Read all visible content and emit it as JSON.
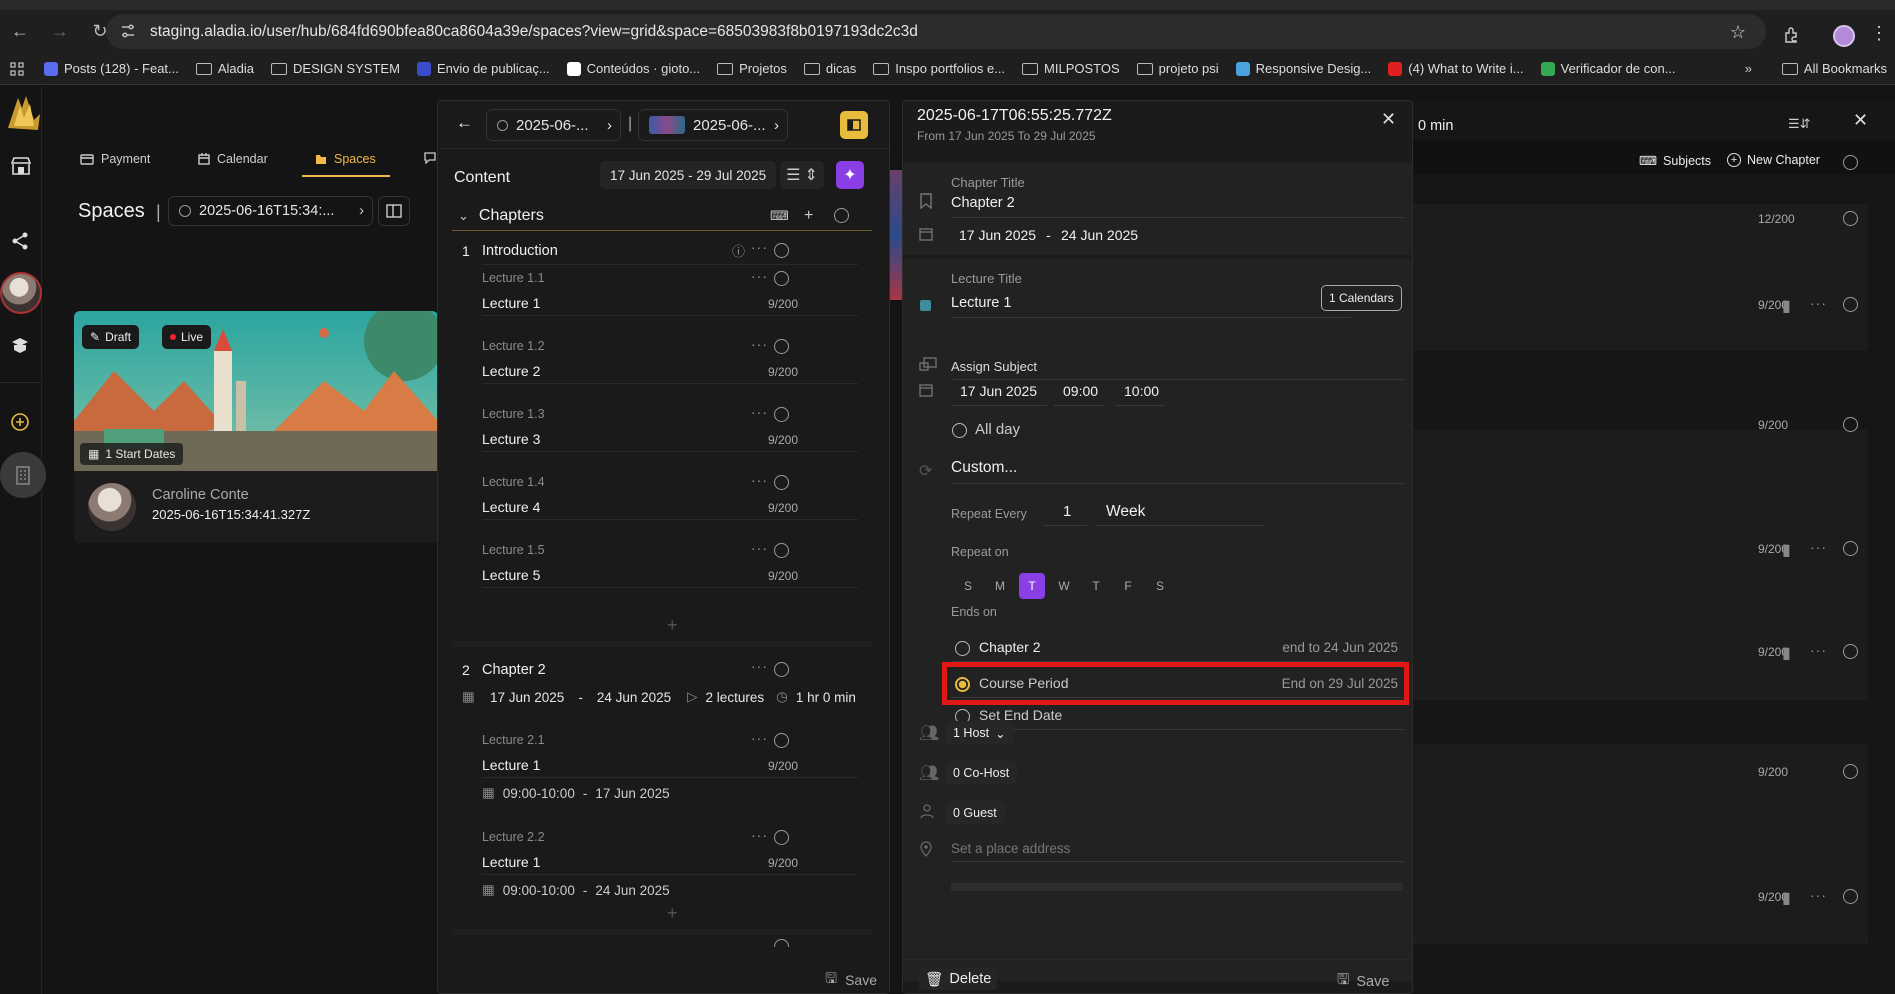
{
  "browser": {
    "url": "staging.aladia.io/user/hub/684fd690bfea80ca8604a39e/spaces?view=grid&space=68503983f8b0197193dc2c3d",
    "bookmarks": [
      {
        "label": "Posts (128) - Feat...",
        "color": "#5b6cf0"
      },
      {
        "label": "Aladia",
        "folder": true
      },
      {
        "label": "DESIGN SYSTEM",
        "folder": true
      },
      {
        "label": "Envio de publicaç...",
        "color": "#3a4cc9"
      },
      {
        "label": "Conteúdos · gioto...",
        "color": "#ffffff"
      },
      {
        "label": "Projetos",
        "folder": true
      },
      {
        "label": "dicas",
        "folder": true
      },
      {
        "label": "Inspo portfolios e...",
        "folder": true
      },
      {
        "label": "MILPOSTOS",
        "folder": true
      },
      {
        "label": "projeto psi",
        "folder": true
      },
      {
        "label": "Responsive Desig...",
        "color": "#4aa3df"
      },
      {
        "label": "(4) What to Write i...",
        "color": "#e02020"
      },
      {
        "label": "Verificador de con...",
        "color": "#34a853"
      }
    ],
    "more": "»",
    "all_bookmarks": "All Bookmarks"
  },
  "app": {
    "nav": {
      "payment": "Payment",
      "calendar": "Calendar",
      "spaces": "Spaces"
    },
    "spaces_title": "Spaces",
    "space_selector": "2025-06-16T15:34:...",
    "card": {
      "draft": "Draft",
      "live": "Live",
      "start_dates": "1 Start Dates",
      "owner_name": "Caroline Conte",
      "owner_date": "2025-06-16T15:34:41.327Z"
    }
  },
  "content_panel": {
    "crumb1": "2025-06-...",
    "crumb2": "2025-06-...",
    "content_label": "Content",
    "date_range": "17 Jun 2025 - 29 Jul 2025",
    "chapters_label": "Chapters",
    "chapter1": {
      "num": "1",
      "title": "Introduction"
    },
    "lectures1": [
      {
        "sub": "Lecture 1.1",
        "title": "Lecture 1",
        "count": "9/200"
      },
      {
        "sub": "Lecture 1.2",
        "title": "Lecture 2",
        "count": "9/200"
      },
      {
        "sub": "Lecture 1.3",
        "title": "Lecture 3",
        "count": "9/200"
      },
      {
        "sub": "Lecture 1.4",
        "title": "Lecture 4",
        "count": "9/200"
      },
      {
        "sub": "Lecture 1.5",
        "title": "Lecture 5",
        "count": "9/200"
      }
    ],
    "chapter2": {
      "num": "2",
      "title": "Chapter 2",
      "start": "17 Jun 2025",
      "dash": "-",
      "end": "24 Jun 2025",
      "lectures_count": "2 lectures",
      "duration": "1 hr 0 min"
    },
    "lectures2": [
      {
        "sub": "Lecture 2.1",
        "title": "Lecture 1",
        "count": "9/200",
        "time": "09:00-10:00",
        "dash": "-",
        "date": "17 Jun 2025"
      },
      {
        "sub": "Lecture 2.2",
        "title": "Lecture 1",
        "count": "9/200",
        "time": "09:00-10:00",
        "dash": "-",
        "date": "24 Jun 2025"
      }
    ],
    "save": "Save"
  },
  "detail": {
    "title": "2025-06-17T06:55:25.772Z",
    "subtitle": "From 17 Jun 2025 To 29 Jul 2025",
    "chapter_title_label": "Chapter Title",
    "chapter_title_value": "Chapter 2",
    "chapter_start": "17 Jun 2025",
    "chapter_dash": "-",
    "chapter_end": "24 Jun 2025",
    "lecture_title_label": "Lecture Title",
    "lecture_title_value": "Lecture 1",
    "calendars_btn": "1 Calendars",
    "assign_subject_label": "Assign Subject",
    "date": "17 Jun 2025",
    "start_time": "09:00",
    "end_time": "10:00",
    "all_day": "All day",
    "custom": "Custom...",
    "repeat_every_label": "Repeat Every",
    "repeat_every_value": "1",
    "repeat_unit": "Week",
    "repeat_on_label": "Repeat on",
    "days": [
      "S",
      "M",
      "T",
      "W",
      "T",
      "F",
      "S"
    ],
    "ends_on_label": "Ends on",
    "ends_options": [
      {
        "label": "Chapter 2",
        "right": "end to 24 Jun 2025"
      },
      {
        "label": "Course Period",
        "right": "End on 29 Jul 2025"
      },
      {
        "label": "Set End Date",
        "right": ""
      }
    ],
    "host": "1 Host",
    "cohost": "0 Co-Host",
    "guest": "0 Guest",
    "place_placeholder": "Set a place address",
    "delete": "Delete",
    "save": "Save",
    "selected_day_color": "#8a3fe6",
    "highlight_color": "#e01818"
  },
  "right_panel": {
    "duration": "0 min",
    "subjects": "Subjects",
    "new_chapter": "New Chapter",
    "counts": [
      "12/200",
      "9/200",
      "9/200",
      "9/200",
      "9/200",
      "9/200",
      "9/200"
    ]
  }
}
